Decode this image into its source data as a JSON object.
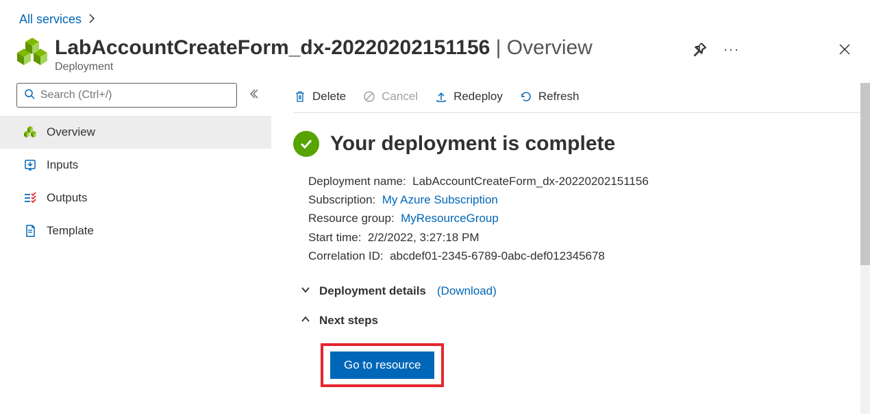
{
  "breadcrumb": {
    "all_services": "All services"
  },
  "header": {
    "title_main": "LabAccountCreateForm_dx-20220202151156",
    "title_suffix": " | Overview",
    "subtitle": "Deployment"
  },
  "search": {
    "placeholder": "Search (Ctrl+/)"
  },
  "sidebar": {
    "items": [
      {
        "label": "Overview"
      },
      {
        "label": "Inputs"
      },
      {
        "label": "Outputs"
      },
      {
        "label": "Template"
      }
    ]
  },
  "toolbar": {
    "delete": "Delete",
    "cancel": "Cancel",
    "redeploy": "Redeploy",
    "refresh": "Refresh"
  },
  "status": {
    "heading": "Your deployment is complete"
  },
  "details": {
    "deployment_name_label": "Deployment name:",
    "deployment_name_value": "LabAccountCreateForm_dx-20220202151156",
    "subscription_label": "Subscription:",
    "subscription_value": "My Azure Subscription",
    "resource_group_label": "Resource group:",
    "resource_group_value": "MyResourceGroup",
    "start_time_label": "Start time:",
    "start_time_value": "2/2/2022, 3:27:18 PM",
    "correlation_label": "Correlation ID:",
    "correlation_value": "abcdef01-2345-6789-0abc-def012345678"
  },
  "sections": {
    "deployment_details": "Deployment details",
    "download": "(Download)",
    "next_steps": "Next steps"
  },
  "buttons": {
    "go_to_resource": "Go to resource"
  }
}
